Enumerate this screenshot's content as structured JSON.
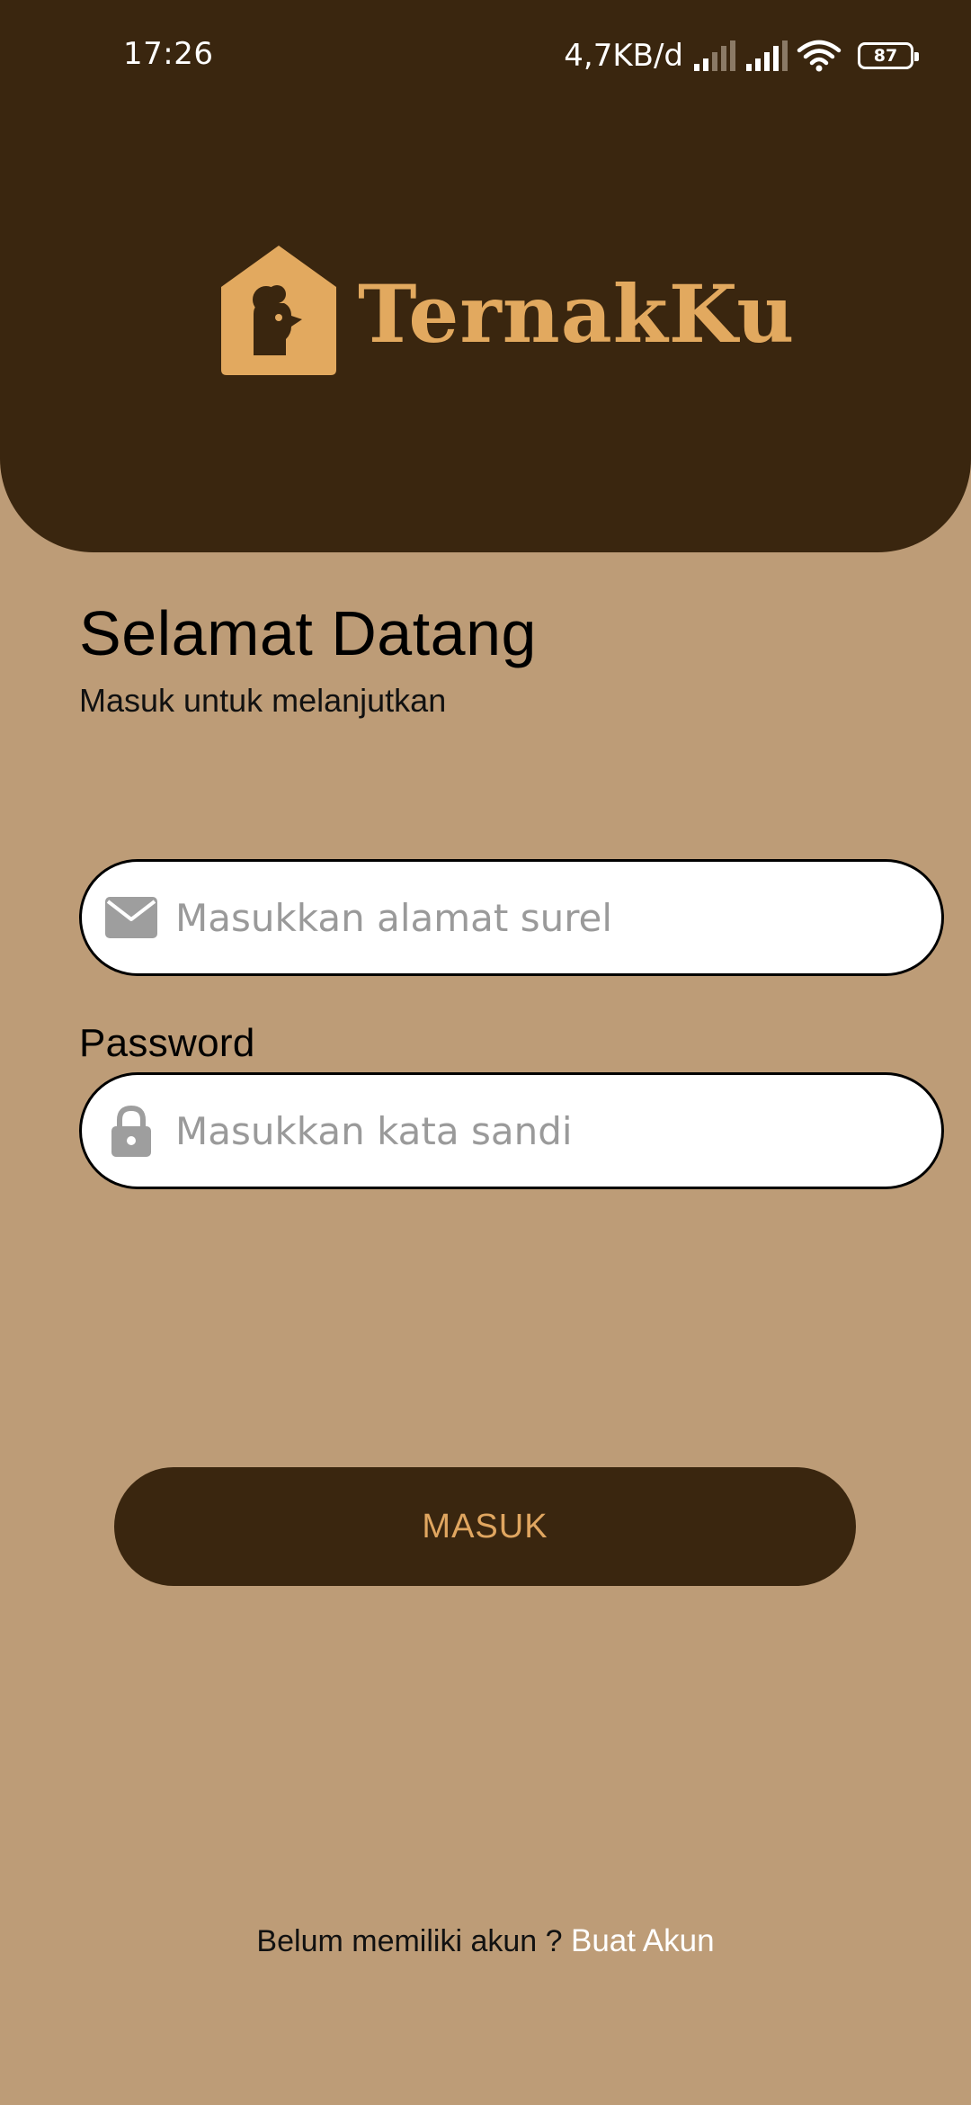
{
  "status_bar": {
    "time": "17:26",
    "network_speed": "4,7KB/d",
    "battery_level": "87"
  },
  "header": {
    "brand_name": "TernakKu",
    "colors": {
      "background": "#3a260f",
      "logo": "#e2a95f"
    }
  },
  "welcome": {
    "title": "Selamat Datang",
    "subtitle": "Masuk untuk melanjutkan"
  },
  "form": {
    "email": {
      "placeholder": "Masukkan alamat surel",
      "value": "",
      "icon": "envelope-icon"
    },
    "password": {
      "label": "Password",
      "placeholder": "Masukkan kata sandi",
      "value": "",
      "icon": "lock-icon"
    },
    "submit_label": "MASUK"
  },
  "footer": {
    "prompt": "Belum memiliki akun ? ",
    "link_label": "Buat Akun"
  },
  "colors": {
    "page_background": "#bd9c77",
    "button_text": "#e0a660",
    "link": "#ffffff"
  }
}
